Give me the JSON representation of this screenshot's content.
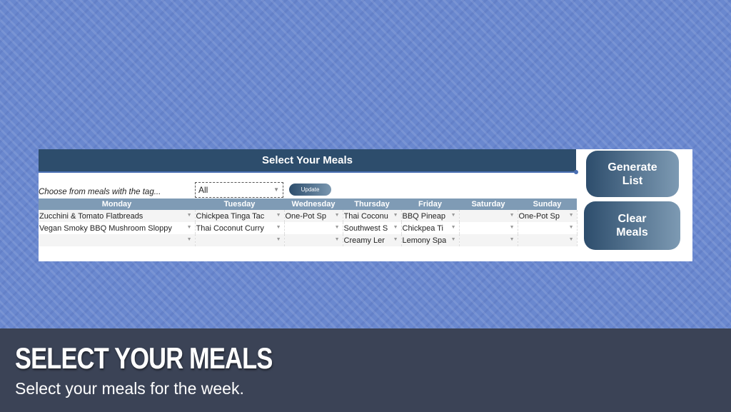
{
  "sheet": {
    "title": "Select Your Meals",
    "tag_label": "Choose from meals with the tag...",
    "tag_value": "All",
    "update_label": "Update",
    "days": [
      "Monday",
      "Tuesday",
      "Wednesday",
      "Thursday",
      "Friday",
      "Saturday",
      "Sunday"
    ],
    "rows": [
      [
        "Zucchini & Tomato Flatbreads",
        "Chickpea Tinga Tac",
        "One-Pot Sp",
        "Thai Coconu",
        "BBQ Pineap",
        "",
        "One-Pot Sp"
      ],
      [
        "Vegan Smoky BBQ Mushroom Sloppy",
        "Thai Coconut Curry",
        "",
        "Southwest S",
        "Chickpea Ti",
        "",
        ""
      ],
      [
        "",
        "",
        "",
        "Creamy Ler",
        "Lemony Spa",
        "",
        ""
      ]
    ]
  },
  "buttons": {
    "generate": [
      "Generate",
      "List"
    ],
    "clear": [
      "Clear",
      "Meals"
    ]
  },
  "caption": {
    "title": "SELECT YOUR MEALS",
    "subtitle": "Select your meals for the week."
  }
}
